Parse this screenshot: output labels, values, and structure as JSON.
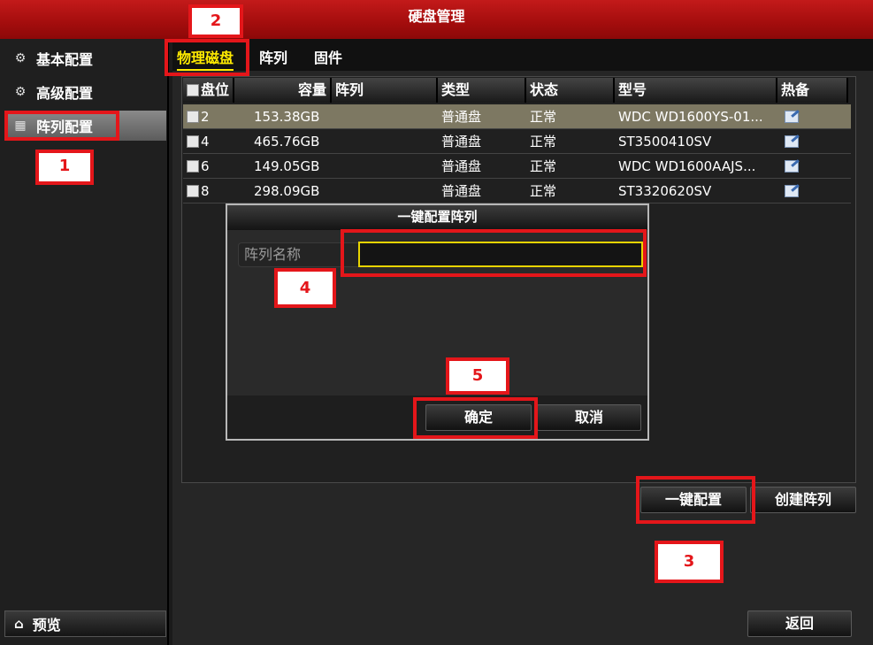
{
  "window": {
    "title": "硬盘管理"
  },
  "sidebar": {
    "items": [
      {
        "label": "基本配置",
        "icon": "gear-icon"
      },
      {
        "label": "高级配置",
        "icon": "advanced-gear-icon"
      },
      {
        "label": "阵列配置",
        "icon": "grid-icon"
      }
    ],
    "preview_label": "预览"
  },
  "tabs": [
    {
      "label": "物理磁盘"
    },
    {
      "label": "阵列"
    },
    {
      "label": "固件"
    }
  ],
  "table": {
    "columns": [
      "盘位",
      "容量",
      "阵列",
      "类型",
      "状态",
      "型号",
      "热备"
    ],
    "rows": [
      {
        "slot": "2",
        "capacity": "153.38GB",
        "array": "",
        "type": "普通盘",
        "status": "正常",
        "model": "WDC WD1600YS-01...",
        "selected": true
      },
      {
        "slot": "4",
        "capacity": "465.76GB",
        "array": "",
        "type": "普通盘",
        "status": "正常",
        "model": "ST3500410SV",
        "selected": false
      },
      {
        "slot": "6",
        "capacity": "149.05GB",
        "array": "",
        "type": "普通盘",
        "status": "正常",
        "model": "WDC WD1600AAJS...",
        "selected": false
      },
      {
        "slot": "8",
        "capacity": "298.09GB",
        "array": "",
        "type": "普通盘",
        "status": "正常",
        "model": "ST3320620SV",
        "selected": false
      }
    ]
  },
  "dialog": {
    "title": "一键配置阵列",
    "field_label": "阵列名称",
    "field_value": "",
    "ok_label": "确定",
    "cancel_label": "取消"
  },
  "actions": {
    "one_click_label": "一键配置",
    "create_array_label": "创建阵列",
    "back_label": "返回"
  },
  "annotations": [
    "1",
    "2",
    "3",
    "4",
    "5"
  ],
  "colors": {
    "title_red": "#b51212",
    "highlight_red": "#e4161a",
    "active_tab_yellow": "#ffea00",
    "selected_row": "#7d7862"
  }
}
